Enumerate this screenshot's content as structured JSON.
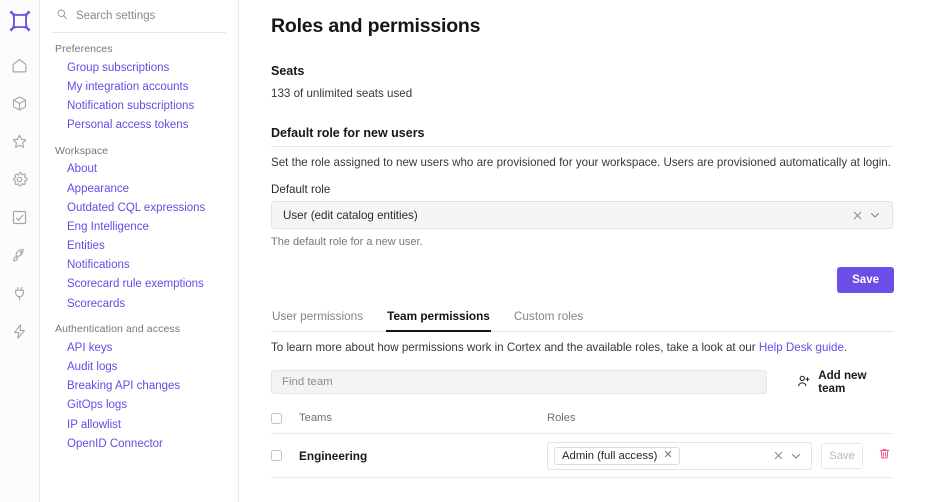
{
  "rail": {
    "logo_name": "cortex-logo",
    "items": [
      {
        "icon": "home-icon",
        "name": "rail-item-home"
      },
      {
        "icon": "cube-icon",
        "name": "rail-item-catalog"
      },
      {
        "icon": "star-icon",
        "name": "rail-item-favorites"
      },
      {
        "icon": "gear-icon",
        "name": "rail-item-settings"
      },
      {
        "icon": "scorecard-icon",
        "name": "rail-item-scorecards"
      },
      {
        "icon": "rocket-icon",
        "name": "rail-item-initiatives"
      },
      {
        "icon": "plug-icon",
        "name": "rail-item-integrations"
      },
      {
        "icon": "lightning-icon",
        "name": "rail-item-workflows"
      }
    ]
  },
  "sidebar": {
    "search": {
      "placeholder": "Search settings",
      "value": ""
    },
    "groups": [
      {
        "label": "Preferences",
        "items": [
          "Group subscriptions",
          "My integration accounts",
          "Notification subscriptions",
          "Personal access tokens"
        ]
      },
      {
        "label": "Workspace",
        "items": [
          "About",
          "Appearance",
          "Outdated CQL expressions",
          "Eng Intelligence",
          "Entities",
          "Notifications",
          "Scorecard rule exemptions",
          "Scorecards"
        ]
      },
      {
        "label": "Authentication and access",
        "items": [
          "API keys",
          "Audit logs",
          "Breaking API changes",
          "GitOps logs",
          "IP allowlist",
          "OpenID Connector"
        ]
      }
    ]
  },
  "main": {
    "title": "Roles and permissions",
    "seats": {
      "heading": "Seats",
      "usage": "133 of unlimited  seats used"
    },
    "default_role_section": {
      "heading": "Default role for new users",
      "description": "Set the role assigned to new users who are provisioned for your workspace. Users are provisioned automatically at login.",
      "field_label": "Default role",
      "selected_value": "User (edit catalog entities)",
      "helper_text": "The default role for a new user.",
      "save_label": "Save"
    },
    "tabs": [
      {
        "label": "User permissions",
        "active": false
      },
      {
        "label": "Team permissions",
        "active": true
      },
      {
        "label": "Custom roles",
        "active": false
      }
    ],
    "help": {
      "prefix": "To learn more about how permissions work in Cortex and the available roles, take a look at our ",
      "link_text": "Help Desk guide",
      "suffix": "."
    },
    "find_team": {
      "placeholder": "Find team",
      "value": ""
    },
    "add_new_team_label": "Add new team",
    "table": {
      "columns": [
        "Teams",
        "Roles"
      ],
      "rows": [
        {
          "team": "Engineering",
          "roles": [
            "Admin (full access)"
          ],
          "save_label": "Save"
        }
      ]
    }
  },
  "colors": {
    "accent_purple": "#6c4de6",
    "link_purple": "#6c48e3",
    "trash_pink": "#f2547d"
  }
}
